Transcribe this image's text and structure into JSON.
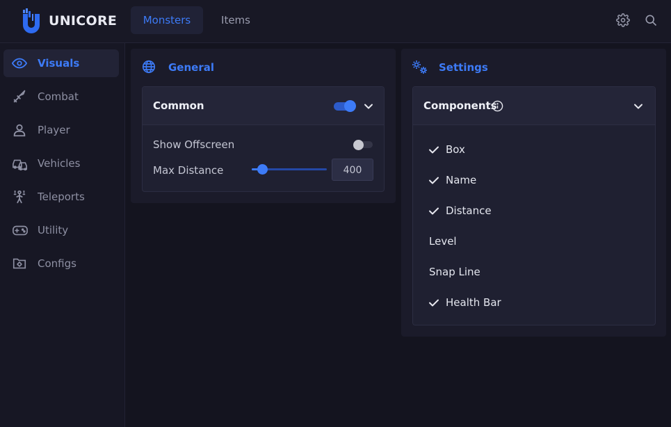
{
  "app": {
    "name": "UNICORE"
  },
  "tabs": [
    {
      "label": "Monsters",
      "active": true
    },
    {
      "label": "Items",
      "active": false
    }
  ],
  "header_icons": [
    "gear-icon",
    "search-icon"
  ],
  "sidebar": {
    "items": [
      {
        "label": "Visuals",
        "icon": "eye-icon",
        "active": true
      },
      {
        "label": "Combat",
        "icon": "sword-icon",
        "active": false
      },
      {
        "label": "Player",
        "icon": "user-icon",
        "active": false
      },
      {
        "label": "Vehicles",
        "icon": "vehicles-icon",
        "active": false
      },
      {
        "label": "Teleports",
        "icon": "teleport-icon",
        "active": false
      },
      {
        "label": "Utility",
        "icon": "gamepad-icon",
        "active": false
      },
      {
        "label": "Configs",
        "icon": "folder-gear-icon",
        "active": false
      }
    ]
  },
  "general": {
    "title": "General",
    "icon": "globe-icon",
    "card": {
      "title": "Common",
      "enabled": true,
      "show_offscreen": {
        "label": "Show Offscreen",
        "enabled": false
      },
      "max_distance": {
        "label": "Max Distance",
        "value": "400",
        "slider_fraction": 0.14
      }
    }
  },
  "settings": {
    "title": "Settings",
    "icon": "gears-icon",
    "components": {
      "title": "Components",
      "items": [
        {
          "label": "Box",
          "checked": true
        },
        {
          "label": "Name",
          "checked": true
        },
        {
          "label": "Distance",
          "checked": true
        },
        {
          "label": "Level",
          "checked": false
        },
        {
          "label": "Snap Line",
          "checked": false
        },
        {
          "label": "Health Bar",
          "checked": true
        }
      ]
    }
  },
  "colors": {
    "accent": "#3d7bf7",
    "background": "#14141f",
    "panel": "#1b1b2a",
    "text_muted": "#8e90a3"
  }
}
